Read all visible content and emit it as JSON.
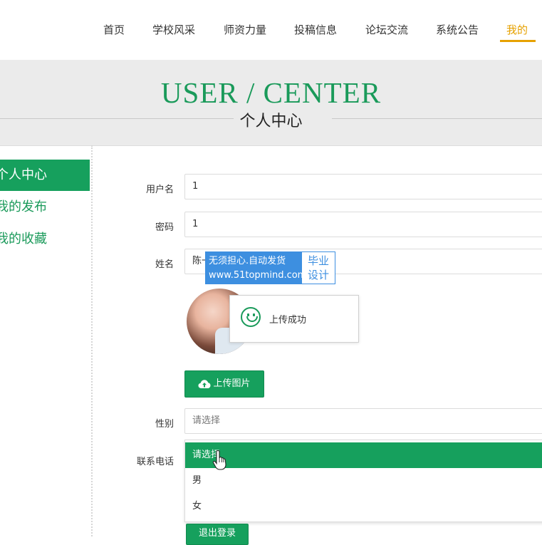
{
  "nav": {
    "items": [
      {
        "label": "首页",
        "active": false
      },
      {
        "label": "学校风采",
        "active": false
      },
      {
        "label": "师资力量",
        "active": false
      },
      {
        "label": "投稿信息",
        "active": false
      },
      {
        "label": "论坛交流",
        "active": false
      },
      {
        "label": "系统公告",
        "active": false
      },
      {
        "label": "我的",
        "active": true
      }
    ]
  },
  "banner": {
    "title": "USER / CENTER",
    "subtitle": "个人中心"
  },
  "sidebar": {
    "items": [
      {
        "label": "个人中心",
        "active": true
      },
      {
        "label": "我的发布",
        "active": false
      },
      {
        "label": "我的收藏",
        "active": false
      }
    ]
  },
  "form": {
    "username": {
      "label": "用户名",
      "value": "1"
    },
    "password": {
      "label": "密码",
      "value": "1"
    },
    "name": {
      "label": "姓名",
      "value": "陈一"
    },
    "upload_button": "上传图片",
    "gender": {
      "label": "性别",
      "placeholder": "请选择",
      "options": [
        "请选择",
        "男",
        "女"
      ],
      "highlighted": "请选择"
    },
    "phone": {
      "label": "联系电话"
    },
    "logout_button": "退出登录"
  },
  "toast": {
    "message": "上传成功"
  },
  "watermark": {
    "line1": "无须担心.自动发货",
    "line2": "www.51topmind.com",
    "badge_line1": "毕业",
    "badge_line2": "设计"
  },
  "colors": {
    "primary": "#16a05d",
    "nav_active": "#e6a100",
    "banner_bg": "#ebebeb",
    "watermark_blue": "#3d8fe0"
  },
  "icons": {
    "upload": "cloud-upload-icon",
    "toast": "smile-icon",
    "cursor": "hand-pointer-icon"
  }
}
